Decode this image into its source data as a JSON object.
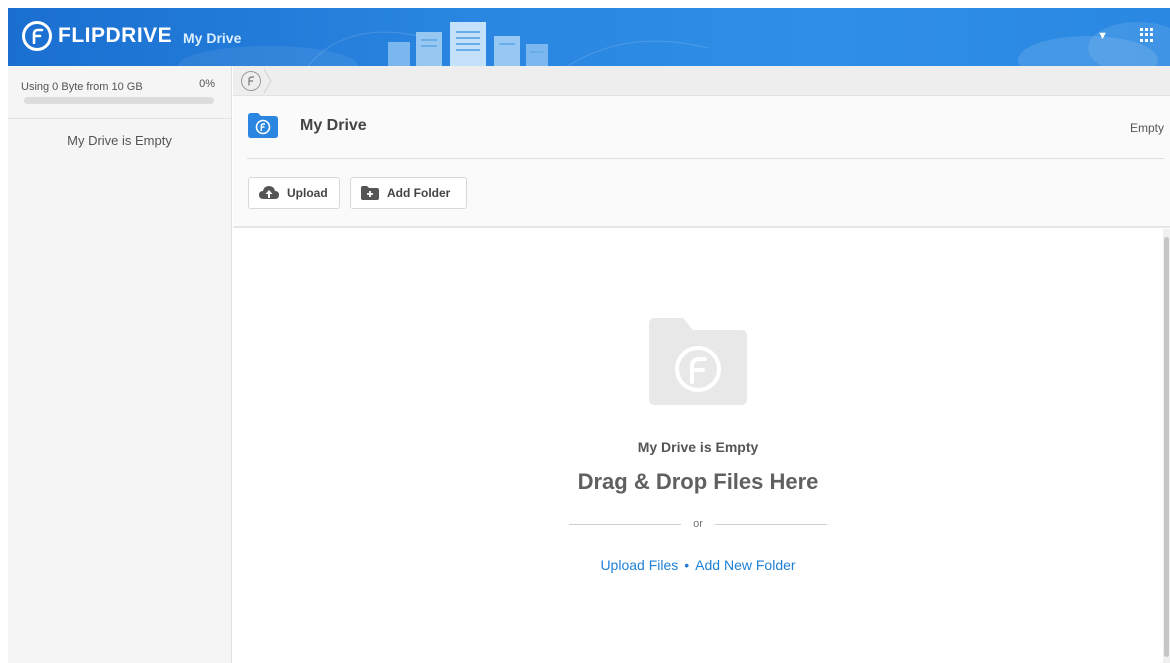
{
  "header": {
    "logo_text": "FLIPDRIVE",
    "title": "My Drive",
    "accent_color": "#2a86e0",
    "icons": [
      "flipdrive-logo-icon",
      "dropdown-caret-icon",
      "apps-grid-icon"
    ]
  },
  "sidebar": {
    "usage_text": "Using 0 Byte from 10 GB",
    "usage_percent_label": "0%",
    "usage_fraction": 0,
    "empty_text": "My Drive is Empty"
  },
  "breadcrumb": {
    "home_icon": "flipdrive-home-icon"
  },
  "title_area": {
    "title": "My Drive",
    "status": "Empty",
    "upload_label": "Upload",
    "add_folder_label": "Add Folder"
  },
  "dropzone": {
    "empty_title": "My Drive is Empty",
    "drag_text": "Drag & Drop Files Here",
    "or_text": "or",
    "upload_link": "Upload Files",
    "separator": "•",
    "add_folder_link": "Add New Folder"
  }
}
